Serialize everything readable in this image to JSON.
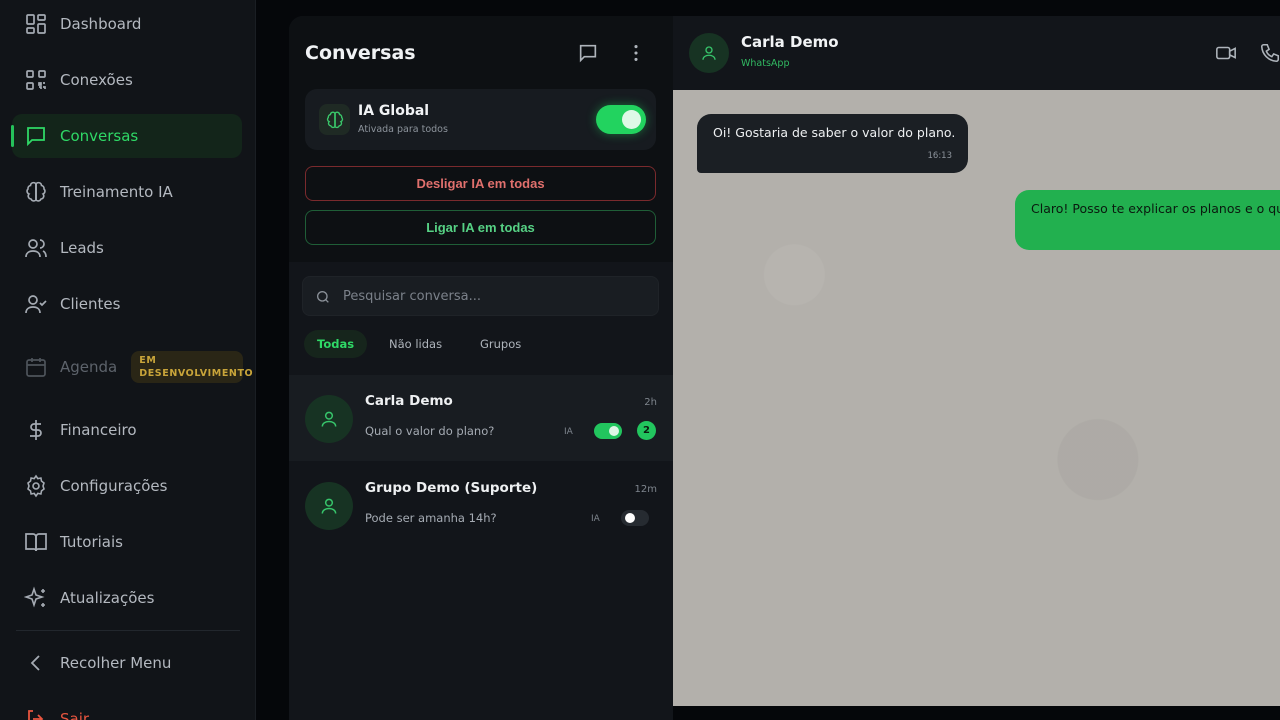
{
  "sidebar": {
    "items": [
      {
        "label": "Dashboard",
        "icon": "grid-icon"
      },
      {
        "label": "Conexões",
        "icon": "qr-code-icon"
      },
      {
        "label": "Conversas",
        "icon": "chat-icon",
        "active": true
      },
      {
        "label": "Treinamento IA",
        "icon": "brain-icon"
      },
      {
        "label": "Leads",
        "icon": "users-icon"
      },
      {
        "label": "Clientes",
        "icon": "user-check-icon"
      },
      {
        "label": "Agenda",
        "icon": "calendar-icon",
        "badge": "EM DESENVOLVIMENTO"
      },
      {
        "label": "Financeiro",
        "icon": "dollar-icon"
      },
      {
        "label": "Configurações",
        "icon": "gear-icon"
      },
      {
        "label": "Tutoriais",
        "icon": "book-icon"
      },
      {
        "label": "Atualizações",
        "icon": "sparkles-icon"
      }
    ],
    "collapse_label": "Recolher Menu",
    "logout_label": "Sair"
  },
  "conversations": {
    "title": "Conversas",
    "ia_global": {
      "title": "IA Global",
      "subtitle": "Ativada para todos",
      "enabled": true
    },
    "disable_all_label": "Desligar IA em todas",
    "enable_all_label": "Ligar IA em todas",
    "search_placeholder": "Pesquisar conversa...",
    "filters": [
      "Todas",
      "Não lidas",
      "Grupos"
    ],
    "items": [
      {
        "name": "Carla Demo",
        "time": "2h",
        "preview": "Qual o valor do plano?",
        "ia_label": "IA",
        "ia_enabled": true,
        "unread": "2"
      },
      {
        "name": "Grupo Demo (Suporte)",
        "time": "12m",
        "preview": "Pode ser amanha 14h?",
        "ia_label": "IA",
        "ia_enabled": false
      }
    ]
  },
  "chat": {
    "contact_name": "Carla Demo",
    "channel": "WhatsApp",
    "messages": [
      {
        "direction": "in",
        "text": "Oi! Gostaria de saber o valor do plano.",
        "time": "16:13"
      },
      {
        "direction": "out",
        "text": "Claro! Posso te explicar os planos e o que"
      }
    ]
  },
  "colors": {
    "accent": "#22c55e",
    "danger": "#e0706d",
    "warning": "#c9a53a",
    "sidebar_bg": "#111418",
    "chat_bg": "#b3b0ab"
  }
}
